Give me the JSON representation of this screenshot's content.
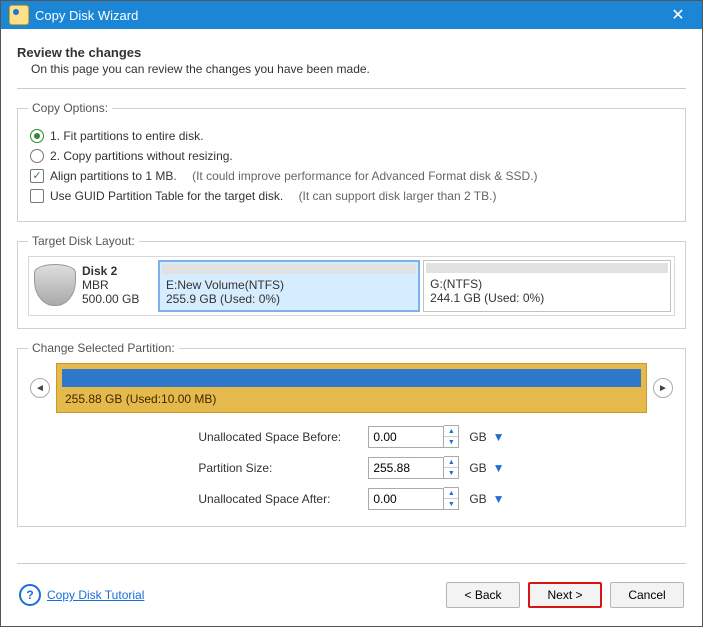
{
  "window": {
    "title": "Copy Disk Wizard"
  },
  "heading": {
    "title": "Review the changes",
    "subtitle": "On this page you can review the changes you have been made."
  },
  "legends": {
    "copy": "Copy Options:",
    "layout": "Target Disk Layout:",
    "change": "Change Selected Partition:"
  },
  "options": {
    "radio1": "1. Fit partitions to entire disk.",
    "radio2": "2. Copy partitions without resizing.",
    "chk1_label": "Align partitions to 1 MB.",
    "chk1_hint": "(It could improve performance for Advanced Format disk & SSD.)",
    "chk2_label": "Use GUID Partition Table for the target disk.",
    "chk2_hint": "(It can support disk larger than 2 TB.)"
  },
  "disk": {
    "name": "Disk 2",
    "style": "MBR",
    "size": "500.00 GB"
  },
  "parts": [
    {
      "label": "E:New Volume(NTFS)",
      "usage": "255.9 GB (Used: 0%)"
    },
    {
      "label": "G:(NTFS)",
      "usage": "244.1 GB (Used: 0%)"
    }
  ],
  "selected": {
    "text": "255.88 GB (Used:10.00 MB)"
  },
  "rows": {
    "before": {
      "label": "Unallocated Space Before:",
      "value": "0.00",
      "unit": "GB"
    },
    "size": {
      "label": "Partition Size:",
      "value": "255.88",
      "unit": "GB"
    },
    "after": {
      "label": "Unallocated Space After:",
      "value": "0.00",
      "unit": "GB"
    }
  },
  "footer": {
    "tutorial": "Copy Disk Tutorial",
    "back": "< Back",
    "next": "Next >",
    "cancel": "Cancel"
  }
}
